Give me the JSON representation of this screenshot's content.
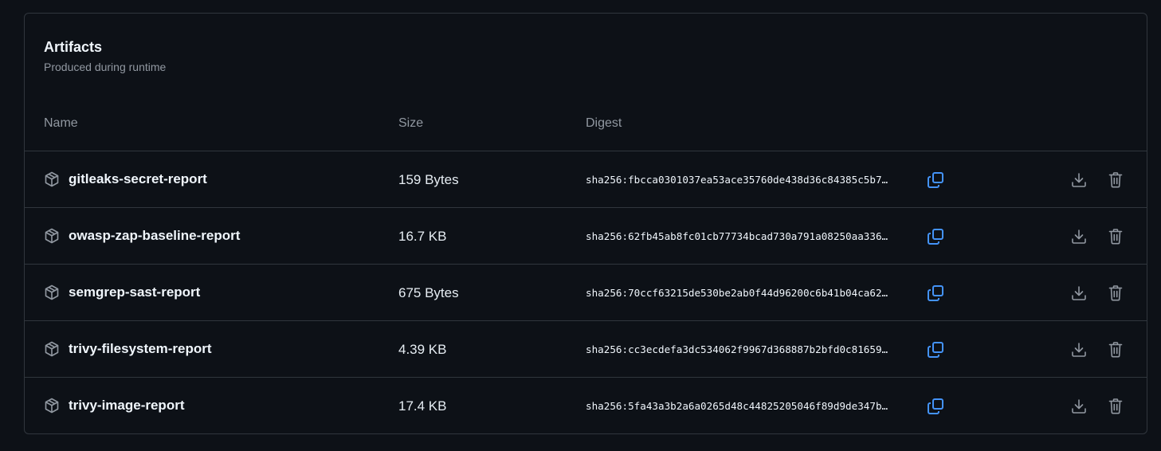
{
  "panel": {
    "title": "Artifacts",
    "subtitle": "Produced during runtime"
  },
  "columns": {
    "name": "Name",
    "size": "Size",
    "digest": "Digest"
  },
  "colors": {
    "background": "#0d1117",
    "border": "#30363d",
    "accent": "#4493f8",
    "muted": "#9198a1"
  },
  "icons": {
    "artifact": "package-icon",
    "copy": "copy-icon",
    "download": "download-icon",
    "delete": "trash-icon"
  },
  "artifacts": [
    {
      "name": "gitleaks-secret-report",
      "size": "159 Bytes",
      "digest": "sha256:fbcca0301037ea53ace35760de438d36c84385c5b7…"
    },
    {
      "name": "owasp-zap-baseline-report",
      "size": "16.7 KB",
      "digest": "sha256:62fb45ab8fc01cb77734bcad730a791a08250aa336…"
    },
    {
      "name": "semgrep-sast-report",
      "size": "675 Bytes",
      "digest": "sha256:70ccf63215de530be2ab0f44d96200c6b41b04ca62…"
    },
    {
      "name": "trivy-filesystem-report",
      "size": "4.39 KB",
      "digest": "sha256:cc3ecdefa3dc534062f9967d368887b2bfd0c81659…"
    },
    {
      "name": "trivy-image-report",
      "size": "17.4 KB",
      "digest": "sha256:5fa43a3b2a6a0265d48c44825205046f89d9de347b…"
    }
  ]
}
